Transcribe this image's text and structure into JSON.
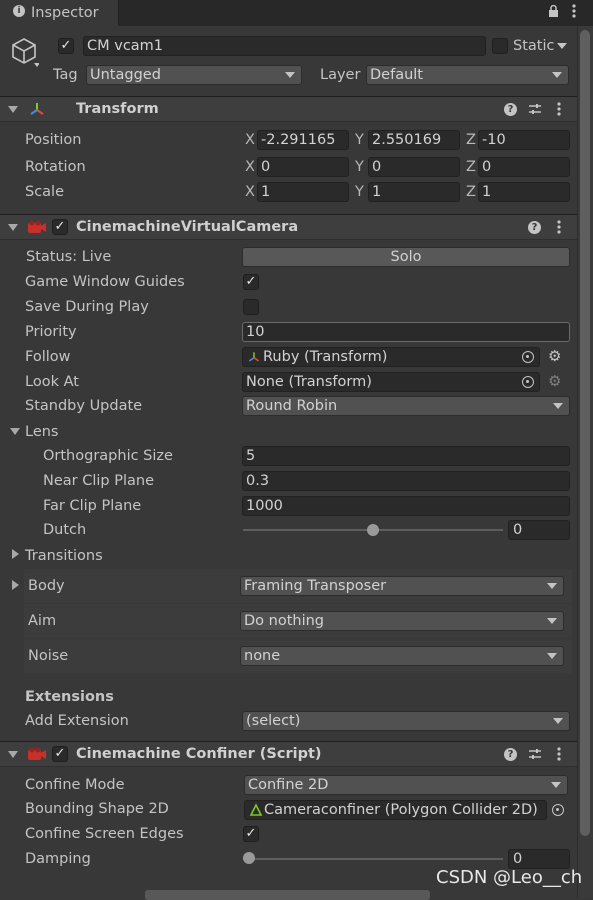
{
  "window": {
    "tab_title": "Inspector"
  },
  "object": {
    "name": "CM vcam1",
    "static_label": "Static",
    "tag_label": "Tag",
    "tag_value": "Untagged",
    "layer_label": "Layer",
    "layer_value": "Default"
  },
  "transform": {
    "title": "Transform",
    "position_label": "Position",
    "rotation_label": "Rotation",
    "scale_label": "Scale",
    "axis_x": "X",
    "axis_y": "Y",
    "axis_z": "Z",
    "position": {
      "x": "-2.291165",
      "y": "2.550169",
      "z": "-10"
    },
    "rotation": {
      "x": "0",
      "y": "0",
      "z": "0"
    },
    "scale": {
      "x": "1",
      "y": "1",
      "z": "1"
    }
  },
  "vcam": {
    "title": "CinemachineVirtualCamera",
    "status_label": "Status: Live",
    "solo_label": "Solo",
    "game_window_guides_label": "Game Window Guides",
    "game_window_guides_checked": true,
    "save_during_play_label": "Save During Play",
    "save_during_play_checked": false,
    "priority_label": "Priority",
    "priority_value": "10",
    "follow_label": "Follow",
    "follow_value": "Ruby (Transform)",
    "look_at_label": "Look At",
    "look_at_value": "None (Transform)",
    "standby_label": "Standby Update",
    "standby_value": "Round Robin",
    "lens_label": "Lens",
    "ortho_label": "Orthographic Size",
    "ortho_value": "5",
    "near_label": "Near Clip Plane",
    "near_value": "0.3",
    "far_label": "Far Clip Plane",
    "far_value": "1000",
    "dutch_label": "Dutch",
    "dutch_value": "0",
    "dutch_slider_fraction": 0.5,
    "transitions_label": "Transitions",
    "body_label": "Body",
    "body_value": "Framing Transposer",
    "aim_label": "Aim",
    "aim_value": "Do nothing",
    "noise_label": "Noise",
    "noise_value": "none",
    "extensions_label": "Extensions",
    "add_extension_label": "Add Extension",
    "add_extension_value": "(select)"
  },
  "confiner": {
    "title": "Cinemachine Confiner (Script)",
    "mode_label": "Confine Mode",
    "mode_value": "Confine 2D",
    "shape_label": "Bounding Shape 2D",
    "shape_value": "Cameraconfiner (Polygon Collider 2D)",
    "edges_label": "Confine Screen Edges",
    "edges_checked": true,
    "damping_label": "Damping",
    "damping_value": "0",
    "damping_slider_fraction": 0.0
  },
  "watermark": "CSDN @Leo__ch",
  "colors": {
    "background": "#383838",
    "field": "#2a2a2a",
    "dropdown": "#515151",
    "header": "#3e3e3e",
    "text": "#c4c4c4",
    "cinemachine_red": "#c8302c"
  },
  "icons": [
    "info-icon",
    "lock-icon",
    "menu-dots-icon",
    "cube-icon",
    "transform-axes-icon",
    "help-icon",
    "preset-icon",
    "cinemachine-icon",
    "target-icon",
    "gear-icon"
  ]
}
